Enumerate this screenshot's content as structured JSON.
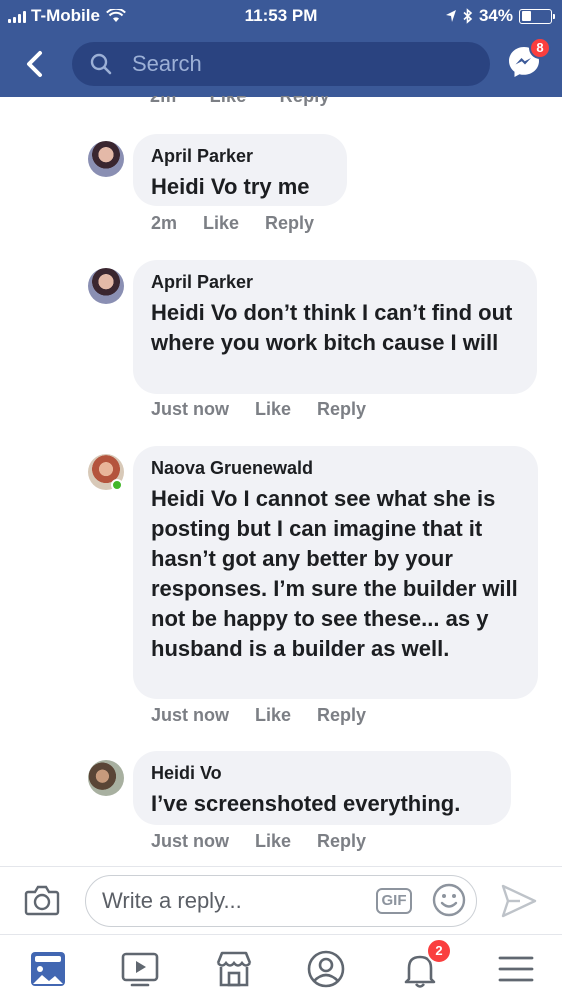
{
  "status_bar": {
    "carrier": "T-Mobile",
    "time": "11:53 PM",
    "battery": "34%",
    "battery_level": 0.34
  },
  "header": {
    "search_placeholder": "Search",
    "messenger_badge": "8"
  },
  "previous_comment_meta": {
    "time": "2m",
    "like_label": "Like",
    "reply_label": "Reply"
  },
  "comments": [
    {
      "author": "April Parker",
      "mention": "Heidi Vo",
      "text": " try me",
      "time": "2m",
      "like_label": "Like",
      "reply_label": "Reply"
    },
    {
      "author": "April Parker",
      "mention": "Heidi Vo",
      "text": "  don’t think I can’t find out where you work bitch cause I will",
      "time": "Just now",
      "like_label": "Like",
      "reply_label": "Reply"
    },
    {
      "author": "Naova Gruenewald",
      "mention": "Heidi Vo",
      "text": " I cannot see what she is posting but I can imagine that it hasn’t got any better by your responses. I’m sure the builder will not be happy to see these... as y husband is a builder as well.",
      "time": "Just now",
      "like_label": "Like",
      "reply_label": "Reply",
      "online": true
    },
    {
      "author": "Heidi Vo",
      "mention": "",
      "text": "I’ve screenshoted everything.",
      "time": "Just now",
      "like_label": "Like",
      "reply_label": "Reply"
    }
  ],
  "composer": {
    "placeholder": "Write a reply...",
    "gif_label": "GIF"
  },
  "bottom_nav": {
    "notifications_badge": "2"
  },
  "colors": {
    "brand": "#3b5998",
    "bubble": "#f1f2f6",
    "meta": "#7c7f85",
    "badge": "#fa3e3e",
    "online": "#42b72a"
  },
  "icons": [
    "back-arrow-icon",
    "search-icon",
    "messenger-icon",
    "camera-icon",
    "gif-icon",
    "emoji-icon",
    "send-icon",
    "news-feed-icon",
    "watch-icon",
    "marketplace-icon",
    "profile-icon",
    "notifications-bell-icon",
    "menu-icon"
  ]
}
